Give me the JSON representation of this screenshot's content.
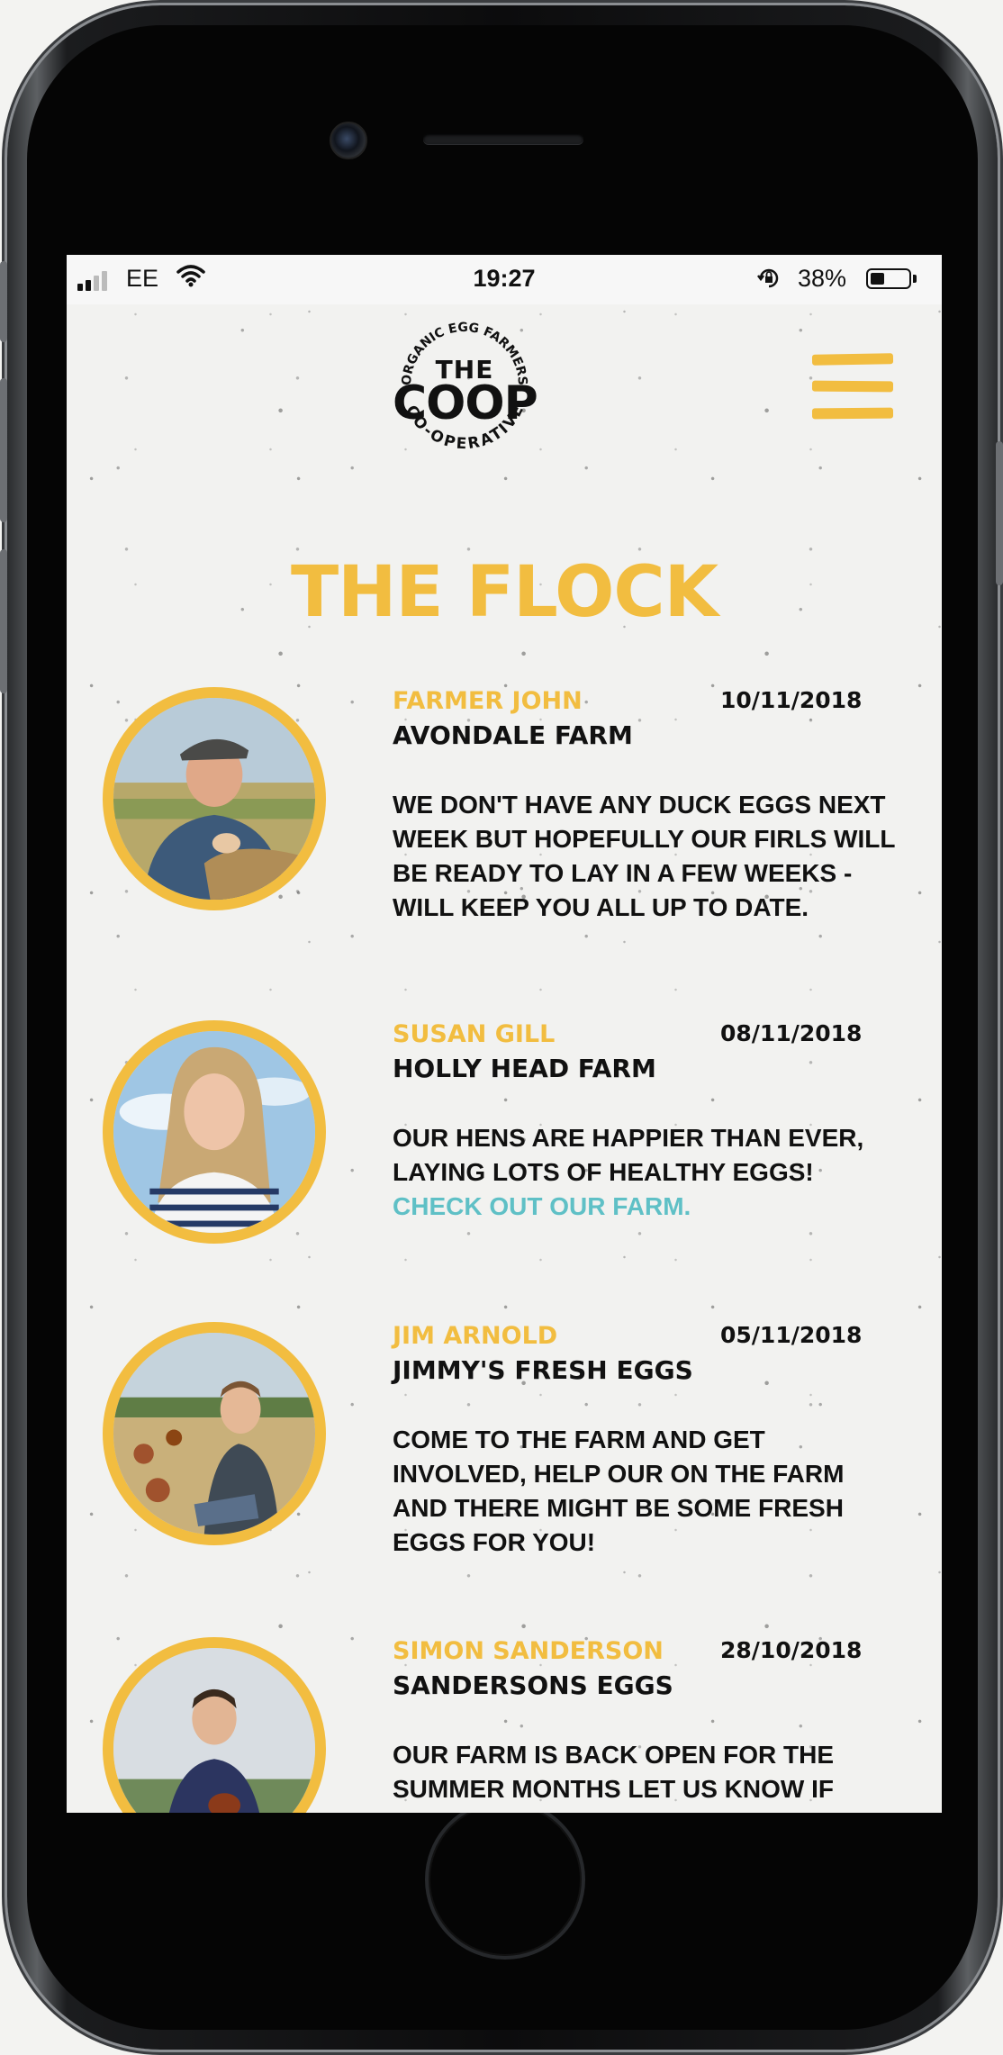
{
  "status_bar": {
    "carrier": "EE",
    "time": "19:27",
    "battery": "38%",
    "battery_level": 0.38,
    "signal_bars_filled": 2
  },
  "brand": {
    "arc_top": "ORGANIC EGG FARMERS",
    "name_top": "THE",
    "name_main": "COOP",
    "arc_bottom": "CO-OPERATIVE"
  },
  "page": {
    "title": "THE FLOCK"
  },
  "colors": {
    "accent": "#f2bd40",
    "text": "#111111",
    "link": "#5fc0c6",
    "background": "#f2f2f0"
  },
  "icons": {
    "menu": "hamburger-menu-icon",
    "wifi": "wifi-icon",
    "signal": "signal-icon",
    "rotation_lock": "rotation-lock-icon",
    "battery": "battery-icon"
  },
  "posts": [
    {
      "name": "FARMER JOHN",
      "date": "10/11/2018",
      "farm": "AVONDALE FARM",
      "message": "WE DON'T HAVE ANY DUCK EGGS NEXT WEEK BUT HOPEFULLY OUR FIRLS WILL BE READY TO LAY IN A FEW WEEKS - WILL KEEP YOU ALL UP TO DATE.",
      "link": ""
    },
    {
      "name": "SUSAN GILL",
      "date": "08/11/2018",
      "farm": "HOLLY HEAD FARM",
      "message": "OUR HENS ARE HAPPIER THAN EVER, LAYING LOTS OF HEALTHY EGGS!",
      "link": "CHECK OUT OUR FARM."
    },
    {
      "name": "JIM ARNOLD",
      "date": "05/11/2018",
      "farm": "JIMMY'S FRESH EGGS",
      "message": "COME TO THE FARM AND GET INVOLVED, HELP OUR ON THE FARM AND THERE MIGHT BE SOME FRESH EGGS FOR YOU!",
      "link": ""
    },
    {
      "name": "SIMON SANDERSON",
      "date": "28/10/2018",
      "farm": "SANDERSONS EGGS",
      "message": "OUR FARM IS BACK OPEN FOR THE SUMMER MONTHS LET US KNOW IF",
      "link": ""
    }
  ]
}
